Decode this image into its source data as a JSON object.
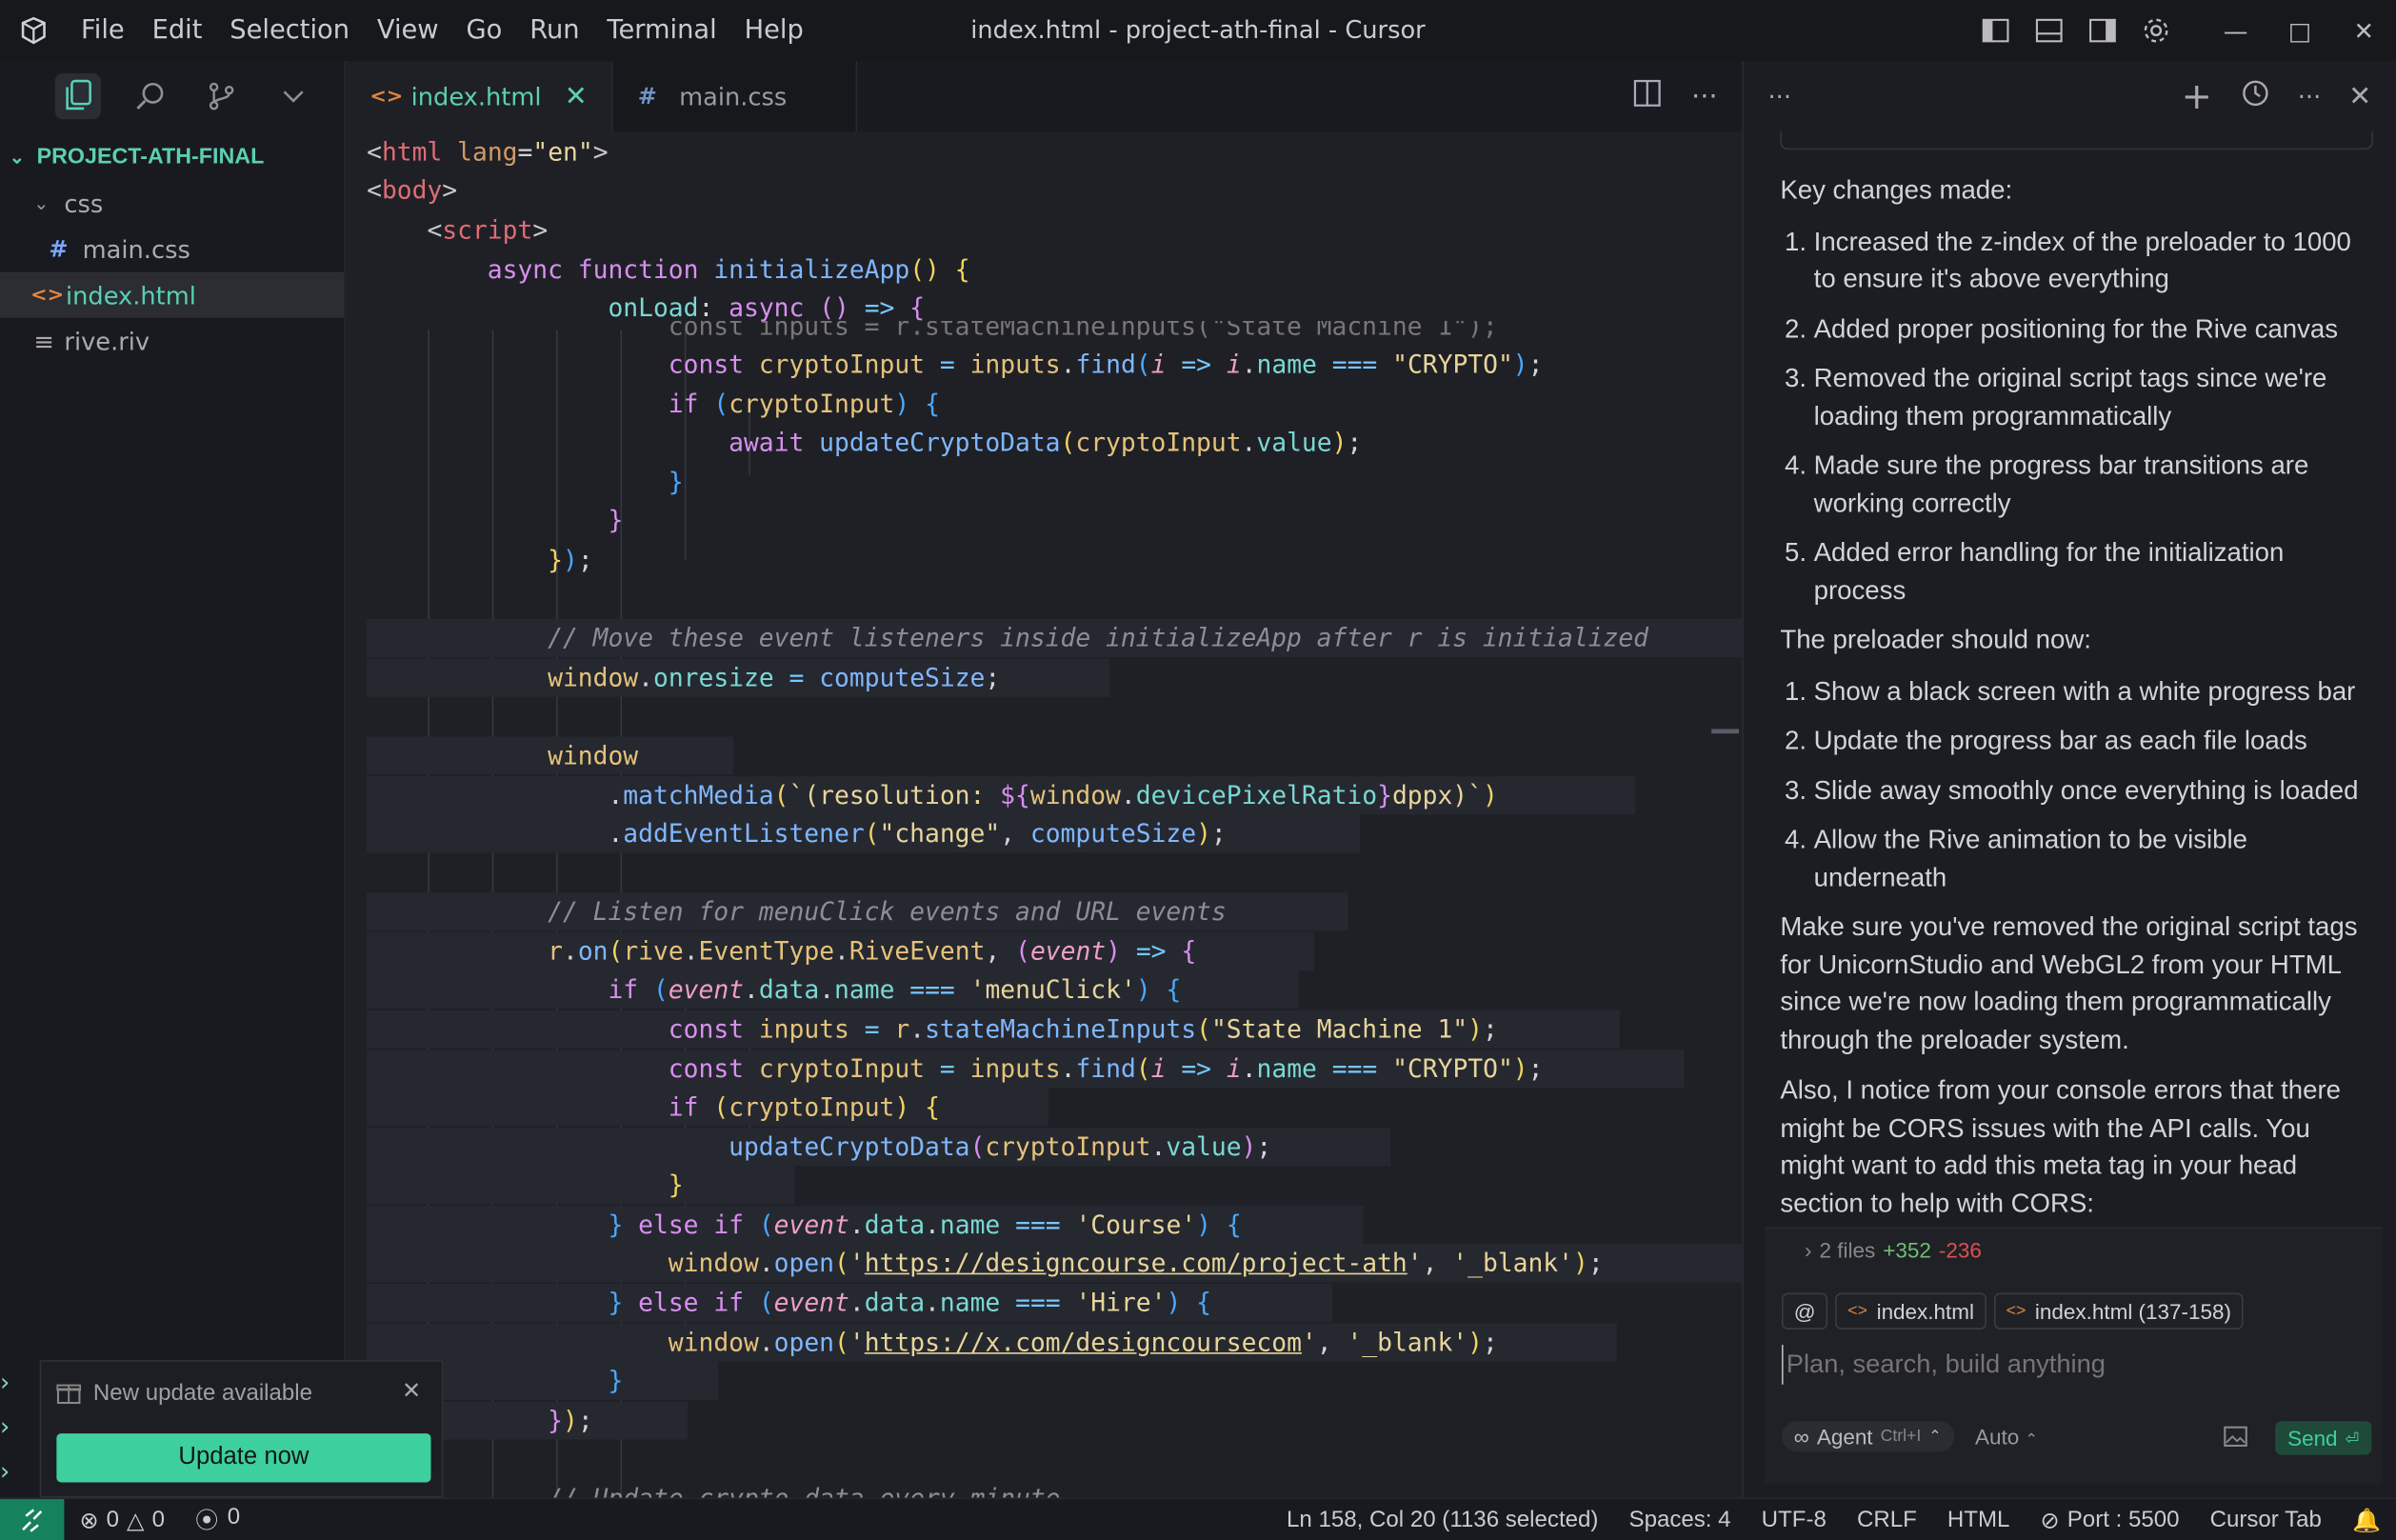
{
  "window": {
    "title": "index.html - project-ath-final - Cursor"
  },
  "menu": [
    "File",
    "Edit",
    "Selection",
    "View",
    "Go",
    "Run",
    "Terminal",
    "Help"
  ],
  "explorer": {
    "root": "PROJECT-ATH-FINAL",
    "items": [
      {
        "name": "css",
        "type": "folder"
      },
      {
        "name": "main.css",
        "type": "css"
      },
      {
        "name": "index.html",
        "type": "html"
      },
      {
        "name": "rive.riv",
        "type": "file"
      }
    ]
  },
  "tabs": [
    {
      "label": "index.html",
      "active": true
    },
    {
      "label": "main.css",
      "active": false
    }
  ],
  "chat": {
    "intro": "Key changes made:",
    "changes": [
      "Increased the z-index of the preloader to 1000 to ensure it's above everything",
      "Added proper positioning for the Rive canvas",
      "Removed the original script tags since we're loading them programmatically",
      "Made sure the progress bar transitions are working correctly",
      "Added error handling for the initialization process"
    ],
    "should_now": "The preloader should now:",
    "steps": [
      "Show a black screen with a white progress bar",
      "Update the progress bar as each file loads",
      "Slide away smoothly once everything is loaded",
      "Allow the Rive animation to be visible underneath"
    ],
    "para1": "Make sure you've removed the original script tags for UnicornStudio and WebGL2 from your HTML since we're now loading them programmatically through the preloader system.",
    "para2": "Also, I notice from your console errors that there might be CORS issues with the API calls. You might want to add this meta tag in your head section to help with CORS:",
    "files_summary": "2 files",
    "additions": "+352",
    "deletions": "-236",
    "context_chips": [
      "index.html",
      "index.html (137-158)"
    ],
    "input_placeholder": "Plan, search, build anything",
    "mode": "Agent",
    "mode_shortcut": "Ctrl+I",
    "model": "Auto",
    "send": "Send"
  },
  "toast": {
    "message": "New update available",
    "button": "Update now"
  },
  "status": {
    "errors": "0",
    "warnings": "0",
    "ports": "0",
    "cursor_pos": "Ln 158, Col 20 (1136 selected)",
    "spaces": "Spaces: 4",
    "encoding": "UTF-8",
    "eol": "CRLF",
    "language": "HTML",
    "port": "Port : 5500",
    "tab": "Cursor Tab"
  },
  "colors": {
    "accent": "#5ad0b2",
    "update_button": "#3ecf9e",
    "remote": "#16825d"
  }
}
